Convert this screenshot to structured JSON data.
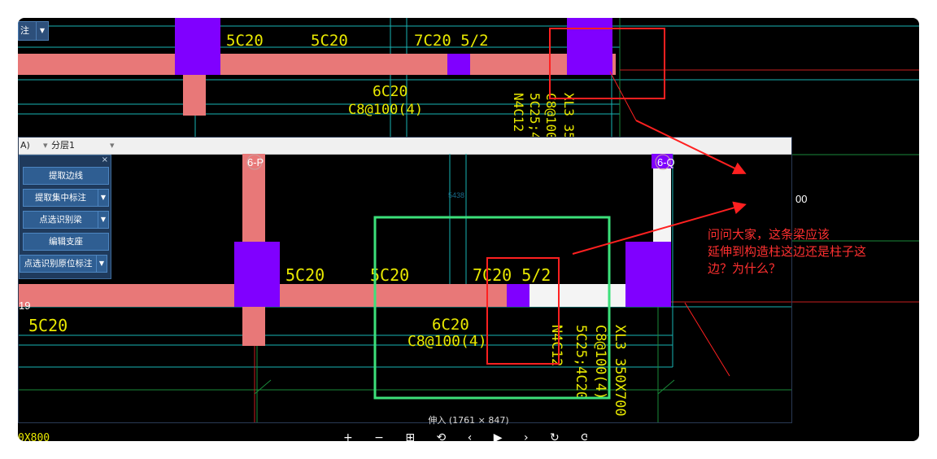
{
  "top_combo": {
    "label": "注"
  },
  "top_cad": {
    "t1": "5C20",
    "t2": "5C20",
    "t3": "7C20 5/2",
    "t4": "6C20",
    "t5": "C8@100(4)",
    "v1": "XL3 35",
    "v2": "C8@100",
    "v3": "5C25;4",
    "v4": "N4C12"
  },
  "inner_bar": {
    "item1": "A)",
    "item2": "分层1"
  },
  "panel": {
    "b1": "提取边线",
    "b2": "提取集中标注",
    "b3": "点选识别梁",
    "b4": "编辑支座",
    "b5": "点选识别原位标注"
  },
  "inner_cad": {
    "axis_p": "6-P",
    "axis_q": "6-Q",
    "axis_19": "19",
    "t1": "5C20",
    "t2": "5C20",
    "t3": "7C20 5/2",
    "t_left": "5C20",
    "t4": "6C20",
    "t5": "C8@100(4)",
    "v1": "XL3 350X700",
    "v2": "C8@100(4)",
    "v3": "5C25;4C20",
    "v4": "N4C12",
    "faint": "5438"
  },
  "right_text": "00",
  "caption": "伸入 (1761 × 847)",
  "bottom_left_text": "0X800",
  "toolbar_glyphs": "+ − ⊞ ⟲ ‹ ▶ › ↻ ⟳ ↔ ↕",
  "question_lines": [
    "问问大家，这条梁应该",
    "延伸到构造柱这边还是柱子这",
    "边？为什么？"
  ],
  "colors": {
    "beam": "#e87878",
    "column": "#8000ff",
    "cyan_line": "#19b5b5",
    "green_line": "#1a8a3a",
    "text_yellow": "#e8e800",
    "annot_red": "#ff2020",
    "annot_green": "#3ce07a"
  }
}
